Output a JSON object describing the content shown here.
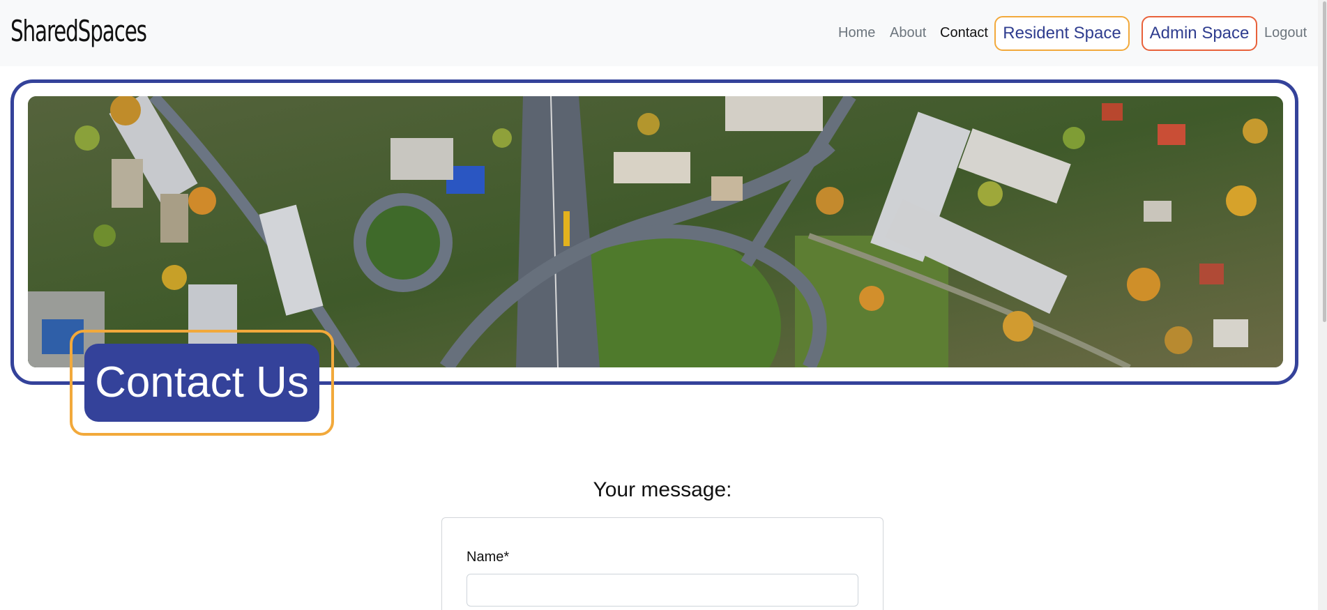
{
  "header": {
    "brand": "SharedSpaces",
    "nav": {
      "home": "Home",
      "about": "About",
      "contact": "Contact",
      "resident_space": "Resident Space",
      "admin_space": "Admin Space",
      "logout": "Logout"
    },
    "active_link": "Contact"
  },
  "hero": {
    "image_subject": "aerial-city-highway-photo",
    "title": "Contact Us"
  },
  "form": {
    "heading": "Your message:",
    "name_label": "Name*",
    "name_value": "",
    "name_placeholder": ""
  },
  "colors": {
    "primary": "#34429a",
    "accent_orange": "#f2a93b",
    "accent_red": "#e8613a",
    "navbar_bg": "#f8f9fa"
  },
  "icons": {
    "hero_image": "aerial-city-image"
  }
}
